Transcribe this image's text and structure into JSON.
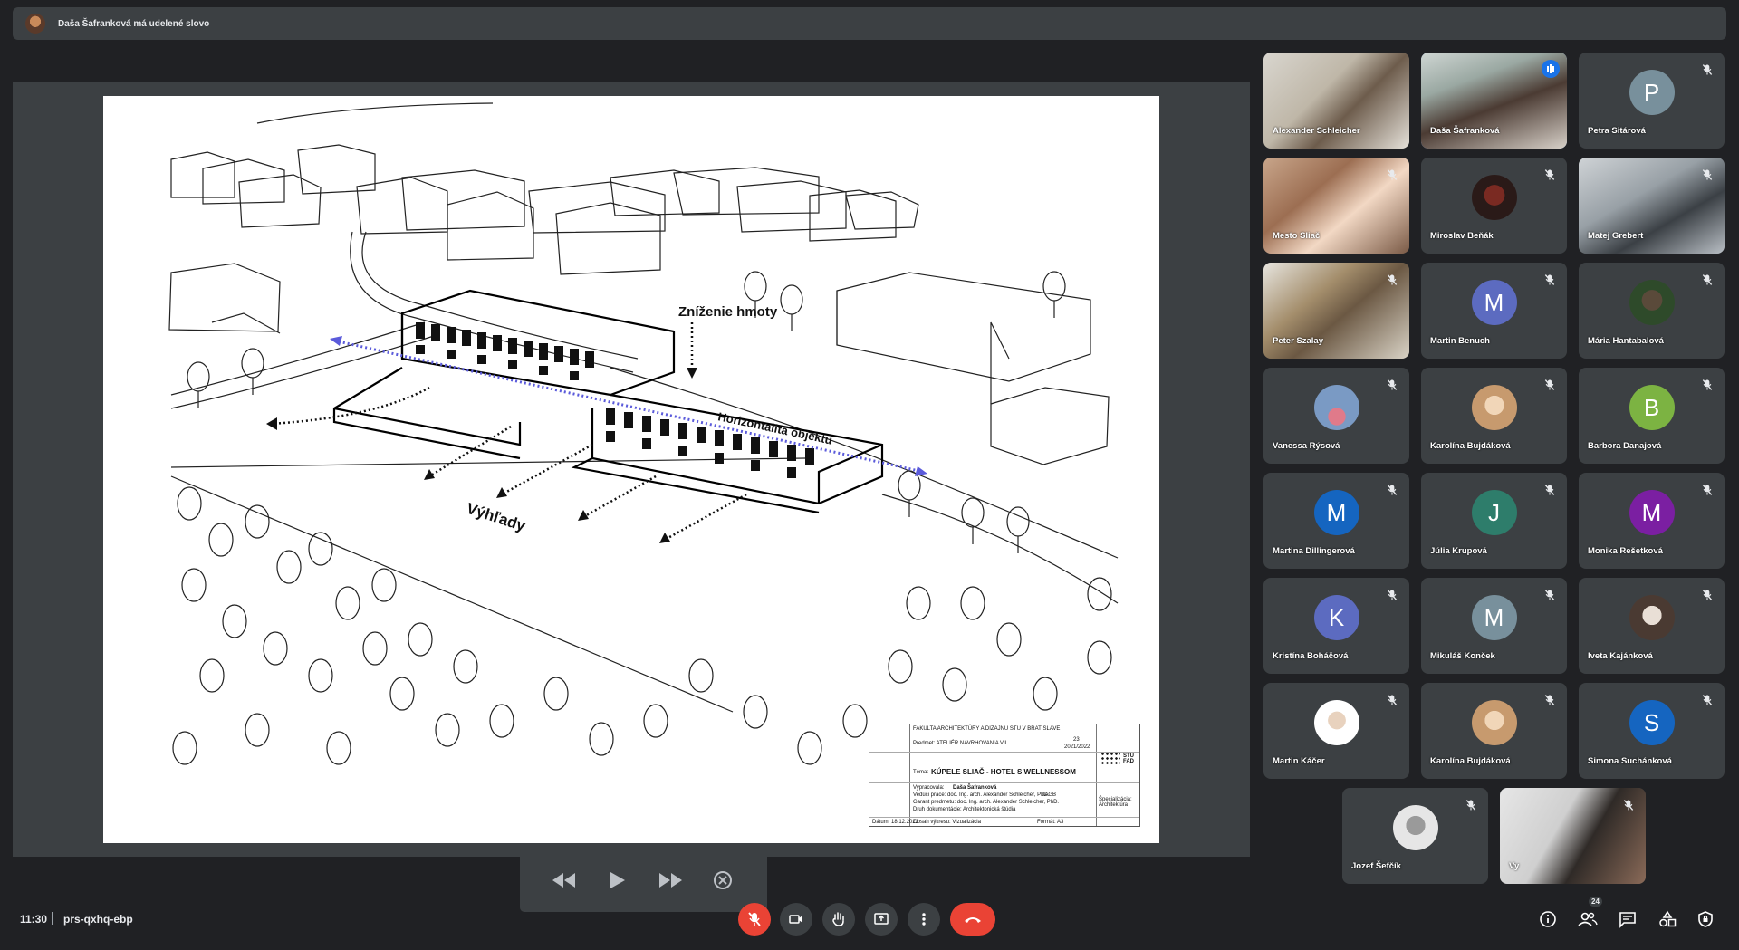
{
  "banner": {
    "text": "Daša Šafranková má udelené slovo"
  },
  "slide": {
    "annotations": {
      "reduction": "Zníženie hmoty",
      "horizontality": "Horizontalita objektu",
      "views": "Výhľady"
    },
    "titleblock": {
      "faculty": "FAKULTA ARCHITEKTÚRY A DIZAJNU STU V BRATISLAVE",
      "subject": "Predmet: ATELIÉR NAVRHOVANIA VII",
      "number": "23",
      "year": "2021/2022",
      "theme_label": "Téma:",
      "theme": "KÚPELE SLIAČ - HOTEL S WELLNESSOM",
      "author_label": "Vypracovala:",
      "author": "Daša Šafranková",
      "supervisor": "Vedúci práce: doc. Ing. arch. Alexander Schleicher, PhD.",
      "code": "0AGB",
      "guarantor": "Garant predmetu: doc. Ing. arch. Alexander Schleicher, PhD.",
      "doctype": "Druh dokumentácie: Architektonická štúdia",
      "specialization": "Špecializácia: Architektúra",
      "date": "Dátum: 18.12.2021",
      "content": "Obsah výkresu: Vizualizácia",
      "format": "Formát: A3",
      "logo": "STU FAD"
    }
  },
  "participants": [
    {
      "name": "Alexander Schleicher",
      "type": "video",
      "muted": false
    },
    {
      "name": "Daša Šafranková",
      "type": "video",
      "speaking": true
    },
    {
      "name": "Petra Sitárová",
      "type": "letter",
      "letter": "P",
      "color": "#78909c",
      "muted": true
    },
    {
      "name": "Mesto Sliač",
      "type": "video",
      "muted": true
    },
    {
      "name": "Miroslav Beňák",
      "type": "photo",
      "muted": true
    },
    {
      "name": "Matej Grebert",
      "type": "video",
      "muted": true
    },
    {
      "name": "Peter Szalay",
      "type": "video",
      "muted": true
    },
    {
      "name": "Martin Benuch",
      "type": "letter",
      "letter": "M",
      "color": "#5c6bc0",
      "muted": true
    },
    {
      "name": "Mária Hantabalová",
      "type": "photo",
      "muted": true
    },
    {
      "name": "Vanessa Rýsová",
      "type": "photo",
      "muted": true
    },
    {
      "name": "Karolína Bujdáková",
      "type": "photo",
      "muted": true
    },
    {
      "name": "Barbora Danajová",
      "type": "letter",
      "letter": "B",
      "color": "#7cb342",
      "muted": true
    },
    {
      "name": "Martina Dillingerová",
      "type": "letter",
      "letter": "M",
      "color": "#1565c0",
      "muted": true
    },
    {
      "name": "Júlia Krupová",
      "type": "letter",
      "letter": "J",
      "color": "#2e7d6b",
      "muted": true
    },
    {
      "name": "Monika Rešetková",
      "type": "letter",
      "letter": "M",
      "color": "#7b1fa2",
      "muted": true
    },
    {
      "name": "Kristína Boháčová",
      "type": "letter",
      "letter": "K",
      "color": "#5c6bc0",
      "muted": true
    },
    {
      "name": "Mikuláš Konček",
      "type": "letter",
      "letter": "M",
      "color": "#78909c",
      "muted": true
    },
    {
      "name": "Iveta Kajánková",
      "type": "photo",
      "muted": true
    },
    {
      "name": "Martin Káčer",
      "type": "photo",
      "muted": true
    },
    {
      "name": "Karolína Bujdáková",
      "type": "photo",
      "muted": true
    },
    {
      "name": "Simona Suchánková",
      "type": "letter",
      "letter": "S",
      "color": "#1565c0",
      "muted": true
    },
    {
      "name": "Jozef Šefčík",
      "type": "photo",
      "muted": true
    },
    {
      "name": "Vy",
      "type": "video",
      "muted": true
    }
  ],
  "bottombar": {
    "time": "11:30",
    "meeting_code": "prs-qxhq-ebp",
    "people_count": "24"
  }
}
